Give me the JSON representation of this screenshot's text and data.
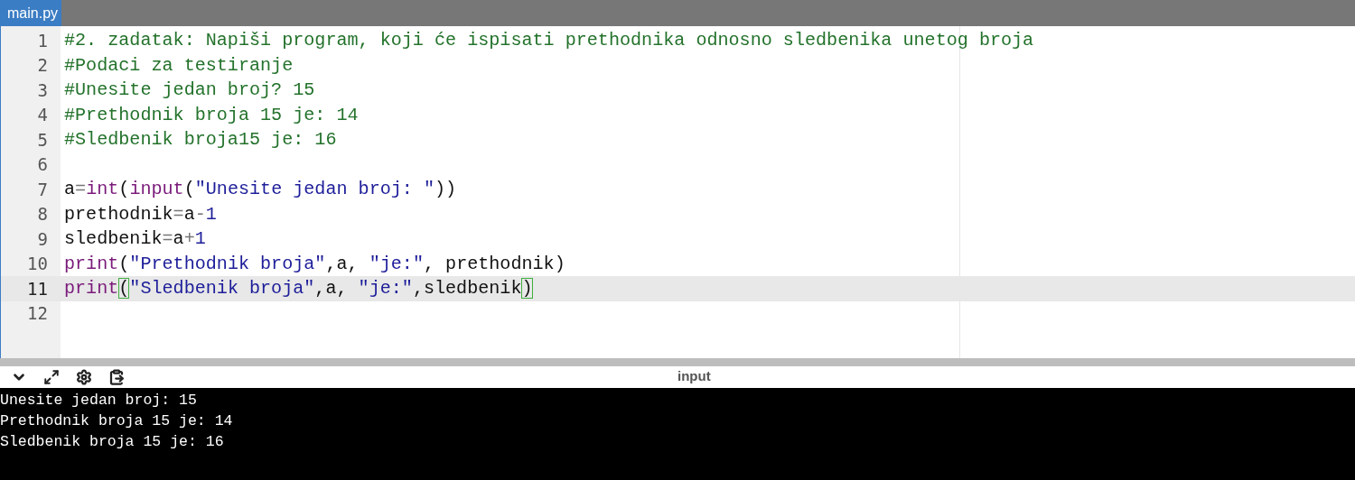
{
  "tabs": [
    {
      "label": "main.py",
      "selected": true
    }
  ],
  "editor": {
    "lines": [
      {
        "number": "1",
        "active": false,
        "tokens": [
          {
            "kind": "comment",
            "text": "#2. zadatak: Napiši program, koji će ispisati prethodnika odnosno sledbenika unetog broja"
          }
        ]
      },
      {
        "number": "2",
        "active": false,
        "tokens": [
          {
            "kind": "comment",
            "text": "#Podaci za testiranje"
          }
        ]
      },
      {
        "number": "3",
        "active": false,
        "tokens": [
          {
            "kind": "comment",
            "text": "#Unesite jedan broj? 15"
          }
        ]
      },
      {
        "number": "4",
        "active": false,
        "tokens": [
          {
            "kind": "comment",
            "text": "#Prethodnik broja 15 je: 14"
          }
        ]
      },
      {
        "number": "5",
        "active": false,
        "tokens": [
          {
            "kind": "comment",
            "text": "#Sledbenik broja15 je: 16"
          }
        ]
      },
      {
        "number": "6",
        "active": false
      },
      {
        "number": "7",
        "active": false,
        "tokens": [
          {
            "kind": "plain",
            "text": "a"
          },
          {
            "kind": "op",
            "text": "="
          },
          {
            "kind": "builtin",
            "text": "int"
          },
          {
            "kind": "plain",
            "text": "("
          },
          {
            "kind": "builtin",
            "text": "input"
          },
          {
            "kind": "plain",
            "text": "("
          },
          {
            "kind": "string",
            "text": "\"Unesite jedan broj: \""
          },
          {
            "kind": "plain",
            "text": "))"
          }
        ]
      },
      {
        "number": "8",
        "active": false,
        "tokens": [
          {
            "kind": "plain",
            "text": "prethodnik"
          },
          {
            "kind": "op",
            "text": "="
          },
          {
            "kind": "plain",
            "text": "a"
          },
          {
            "kind": "op",
            "text": "-"
          },
          {
            "kind": "number",
            "text": "1"
          }
        ]
      },
      {
        "number": "9",
        "active": false,
        "tokens": [
          {
            "kind": "plain",
            "text": "sledbenik"
          },
          {
            "kind": "op",
            "text": "="
          },
          {
            "kind": "plain",
            "text": "a"
          },
          {
            "kind": "op",
            "text": "+"
          },
          {
            "kind": "number",
            "text": "1"
          }
        ]
      },
      {
        "number": "10",
        "active": false,
        "tokens": [
          {
            "kind": "builtin",
            "text": "print"
          },
          {
            "kind": "plain",
            "text": "("
          },
          {
            "kind": "string",
            "text": "\"Prethodnik broja\""
          },
          {
            "kind": "plain",
            "text": ",a, "
          },
          {
            "kind": "string",
            "text": "\"je:\""
          },
          {
            "kind": "plain",
            "text": ", prethodnik)"
          }
        ]
      },
      {
        "number": "11",
        "active": true,
        "tokens": [
          {
            "kind": "builtin",
            "text": "print"
          },
          {
            "kind": "match",
            "text": "("
          },
          {
            "kind": "string",
            "text": "\"Sledbenik broja\""
          },
          {
            "kind": "plain",
            "text": ",a, "
          },
          {
            "kind": "string",
            "text": "\"je:\""
          },
          {
            "kind": "plain",
            "text": ",sledbenik"
          },
          {
            "kind": "match",
            "text": ")"
          }
        ]
      },
      {
        "number": "12",
        "active": false
      }
    ]
  },
  "console": {
    "title": "input",
    "lines": [
      "Unesite jedan broj: 15",
      "Prethodnik broja 15 je: 14",
      "Sledbenik broja 15 je: 16"
    ]
  }
}
